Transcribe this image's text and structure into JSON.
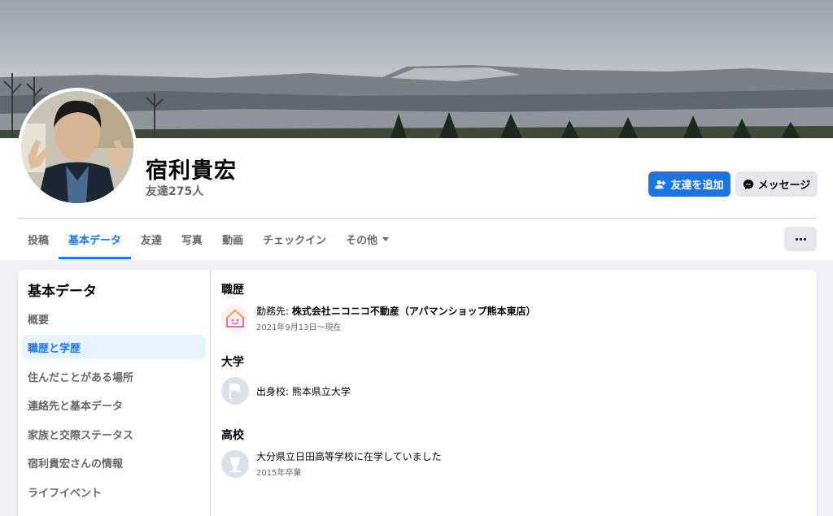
{
  "profile": {
    "name": "宿利貴宏",
    "friends_count": "友達275人"
  },
  "actions": {
    "add_friend": "友達を追加",
    "message": "メッセージ",
    "more": "..."
  },
  "tabs": [
    {
      "label": "投稿"
    },
    {
      "label": "基本データ",
      "active": true
    },
    {
      "label": "友達"
    },
    {
      "label": "写真"
    },
    {
      "label": "動画"
    },
    {
      "label": "チェックイン"
    },
    {
      "label": "その他"
    }
  ],
  "sidebar": {
    "title": "基本データ",
    "items": [
      {
        "label": "概要"
      },
      {
        "label": "職歴と学歴",
        "active": true
      },
      {
        "label": "住んだことがある場所"
      },
      {
        "label": "連絡先と基本データ"
      },
      {
        "label": "家族と交際ステータス"
      },
      {
        "label": "宿利貴宏さんの情報"
      },
      {
        "label": "ライフイベント"
      }
    ]
  },
  "sections": {
    "work": {
      "title": "職歴",
      "prefix": "勤務先: ",
      "employer": "株式会社ニコニコ不動産（アパマンショップ熊本東店）",
      "period": "2021年9月13日～現在"
    },
    "university": {
      "title": "大学",
      "text": "出身校: 熊本県立大学"
    },
    "highschool": {
      "title": "高校",
      "text": "大分県立日田高等学校に在学していました",
      "sub": "2015年卒業"
    }
  },
  "colors": {
    "accent": "#1877f2",
    "button_primary": "#1b74e4",
    "secondary_text": "#65676b",
    "background": "#f0f2f5"
  }
}
